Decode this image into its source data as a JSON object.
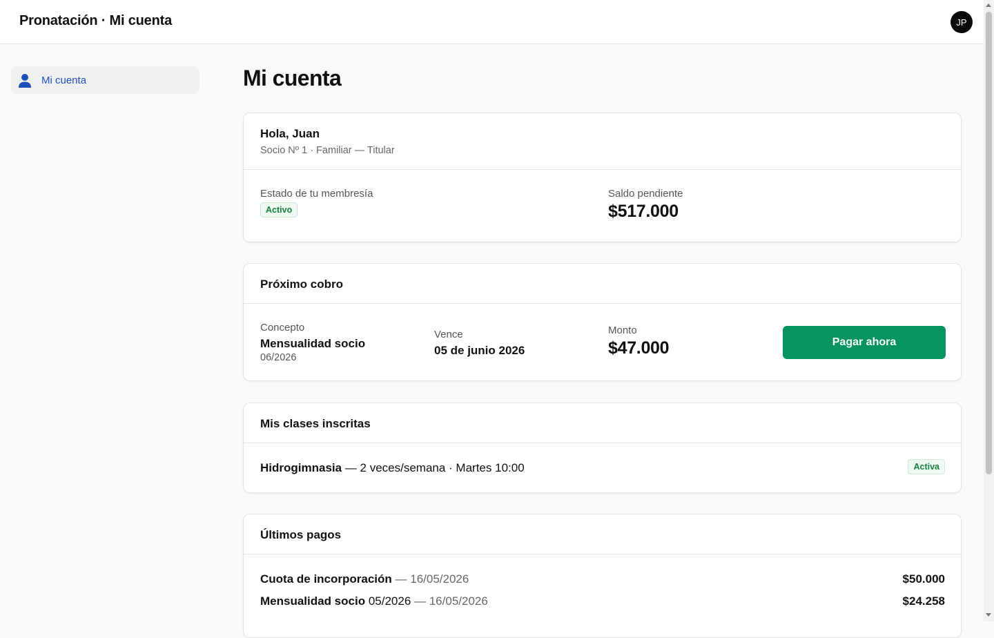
{
  "header": {
    "title": "Pronatación · Mi cuenta",
    "avatar_initials": "JP"
  },
  "sidebar": {
    "items": [
      {
        "label": "Mi cuenta",
        "icon": "user-icon",
        "active": true
      }
    ]
  },
  "main": {
    "title": "Mi cuenta",
    "greeting": {
      "title": "Hola, Juan",
      "subtitle": "Socio Nº 1 · Familiar — Titular",
      "membership_label": "Estado de tu membresía",
      "membership_status": "Activo",
      "balance_label": "Saldo pendiente",
      "balance_value": "$517.000"
    },
    "next_charge": {
      "title": "Próximo cobro",
      "concept_label": "Concepto",
      "concept_value": "Mensualidad socio",
      "concept_period": "06/2026",
      "due_label": "Vence",
      "due_value": "05 de junio 2026",
      "amount_label": "Monto",
      "amount_value": "$47.000",
      "pay_button": "Pagar ahora"
    },
    "classes": {
      "title": "Mis clases inscritas",
      "items": [
        {
          "name": "Hidrogimnasia",
          "detail": " — 2 veces/semana · Martes 10:00",
          "status": "Activa"
        }
      ]
    },
    "payments": {
      "title": "Últimos pagos",
      "items": [
        {
          "concept": "Cuota de incorporación",
          "extra": "",
          "date": " — 16/05/2026",
          "amount": "$50.000"
        },
        {
          "concept": "Mensualidad socio",
          "extra": " 05/2026",
          "date": " — 16/05/2026",
          "amount": "$24.258"
        }
      ]
    }
  },
  "colors": {
    "accent_blue": "#1d4fb8",
    "pay_green": "#05935f",
    "badge_green": "#16803c"
  }
}
